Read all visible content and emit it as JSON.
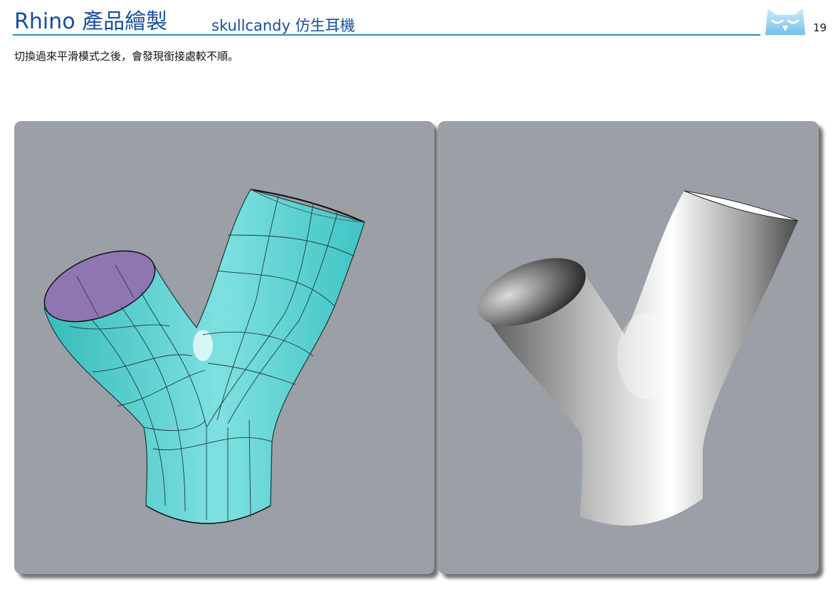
{
  "header": {
    "title": "Rhino 產品繪製",
    "subtitle": "skullcandy 仿生耳機",
    "page_number": "19",
    "logo_icon": "owl-logo-icon",
    "accent_color": "#1a4d99",
    "rule_color": "#2a8fc8"
  },
  "caption": "切換過來平滑模式之後，會發現銜接處較不順。",
  "viewports": {
    "left": {
      "icon": "wireframe-y-pipe-icon",
      "surface_color": "#4ccfcf",
      "inner_color": "#8f76b3"
    },
    "right": {
      "icon": "shaded-y-pipe-icon",
      "surface_color": "#e0e0e0"
    },
    "background_color": "#9ba0a7"
  }
}
